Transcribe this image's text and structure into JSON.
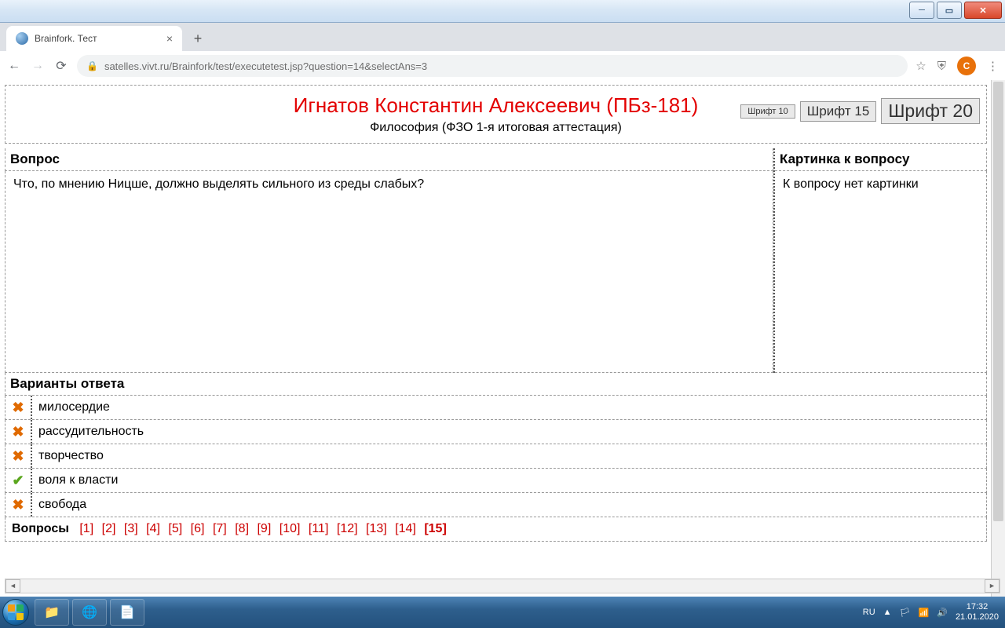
{
  "window": {
    "title": "Brainfork. Тест"
  },
  "browser": {
    "tab_title": "Brainfork. Тест",
    "url": "satelles.vivt.ru/Brainfork/test/executetest.jsp?question=14&selectAns=3",
    "avatar_initial": "C"
  },
  "header": {
    "student": "Игнатов Константин Алексеевич (ПБз-181)",
    "course": "Философия (ФЗО 1-я итоговая аттестация)",
    "font_buttons": {
      "s10": "Шрифт 10",
      "s15": "Шрифт 15",
      "s20": "Шрифт 20"
    }
  },
  "labels": {
    "question": "Вопрос",
    "picture": "Картинка к вопросу",
    "no_picture": "К вопросу нет картинки",
    "answers": "Варианты ответа",
    "questions_nav": "Вопросы"
  },
  "question_text": "Что, по мнению Ницше, должно выделять сильного из среды слабых?",
  "answers": [
    {
      "text": "милосердие",
      "correct": false
    },
    {
      "text": "рассудительность",
      "correct": false
    },
    {
      "text": "творчество",
      "correct": false
    },
    {
      "text": "воля к власти",
      "correct": true
    },
    {
      "text": "свобода",
      "correct": false
    }
  ],
  "nav": {
    "total": 15,
    "current": 15
  },
  "taskbar": {
    "lang": "RU",
    "time": "17:32",
    "date": "21.01.2020"
  }
}
